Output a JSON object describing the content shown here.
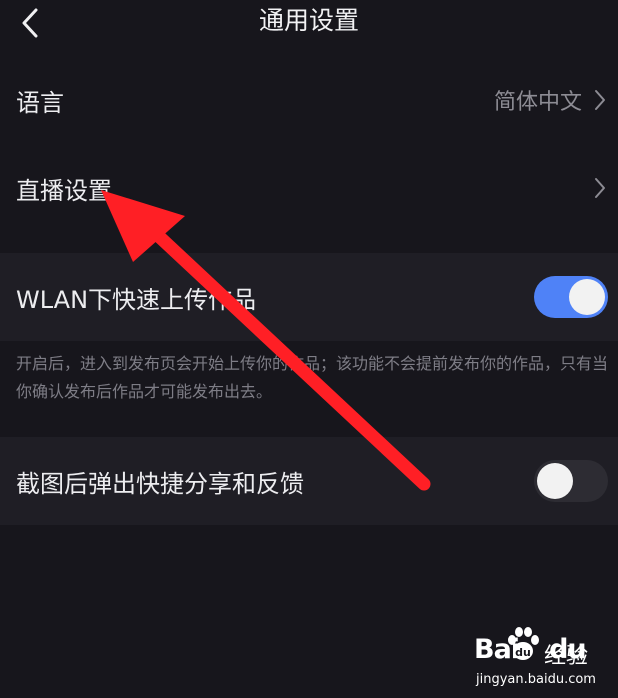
{
  "header": {
    "title": "通用设置"
  },
  "settings": {
    "language": {
      "label": "语言",
      "value": "简体中文"
    },
    "live": {
      "label": "直播设置"
    },
    "wlan_upload": {
      "label": "WLAN下快速上传作品",
      "enabled": true,
      "description": "开启后，进入到发布页会开始上传你的作品；该功能不会提前发布你的作品，只有当你确认发布后作品才可能发布出去。"
    },
    "screenshot_share": {
      "label": "截图后弹出快捷分享和反馈",
      "enabled": false
    }
  },
  "colors": {
    "background": "#17161c",
    "toggle_on": "#4f82f7",
    "arrow": "#ff1f25"
  },
  "watermark": {
    "logo": "Bai",
    "logo2": "du",
    "name": "经验",
    "url": "jingyan.baidu.com"
  }
}
